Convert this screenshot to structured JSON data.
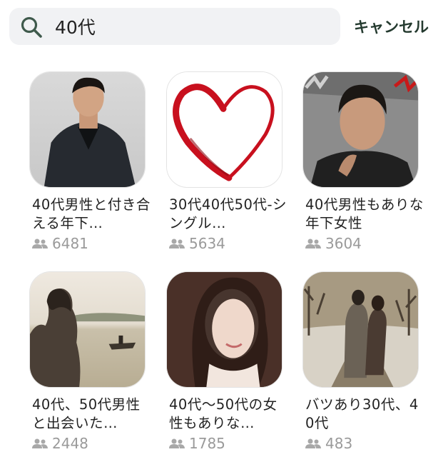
{
  "search": {
    "query": "40代",
    "cancel_label": "キャンセル",
    "icon": "search-icon"
  },
  "results": [
    {
      "title": "40代男性と付き合える年下…",
      "members": "6481",
      "image": "man-in-suit-photo"
    },
    {
      "title": "30代40代50代-シングル…",
      "members": "5634",
      "image": "red-heart-illustration"
    },
    {
      "title": "40代男性もありな年下女性",
      "members": "3604",
      "image": "man-portrait-photo"
    },
    {
      "title": "40代、50代男性と出会いた…",
      "members": "2448",
      "image": "woman-by-lake-photo"
    },
    {
      "title": "40代〜50代の女性もありな…",
      "members": "1785",
      "image": "woman-portrait-photo"
    },
    {
      "title": "バツあり30代、40代",
      "members": "483",
      "image": "couple-walking-photo"
    }
  ],
  "colors": {
    "search_bg": "#f1f2f4",
    "cancel_text": "#243a2f",
    "meta_text": "#9a9a9a",
    "heart_red": "#c8101e"
  }
}
